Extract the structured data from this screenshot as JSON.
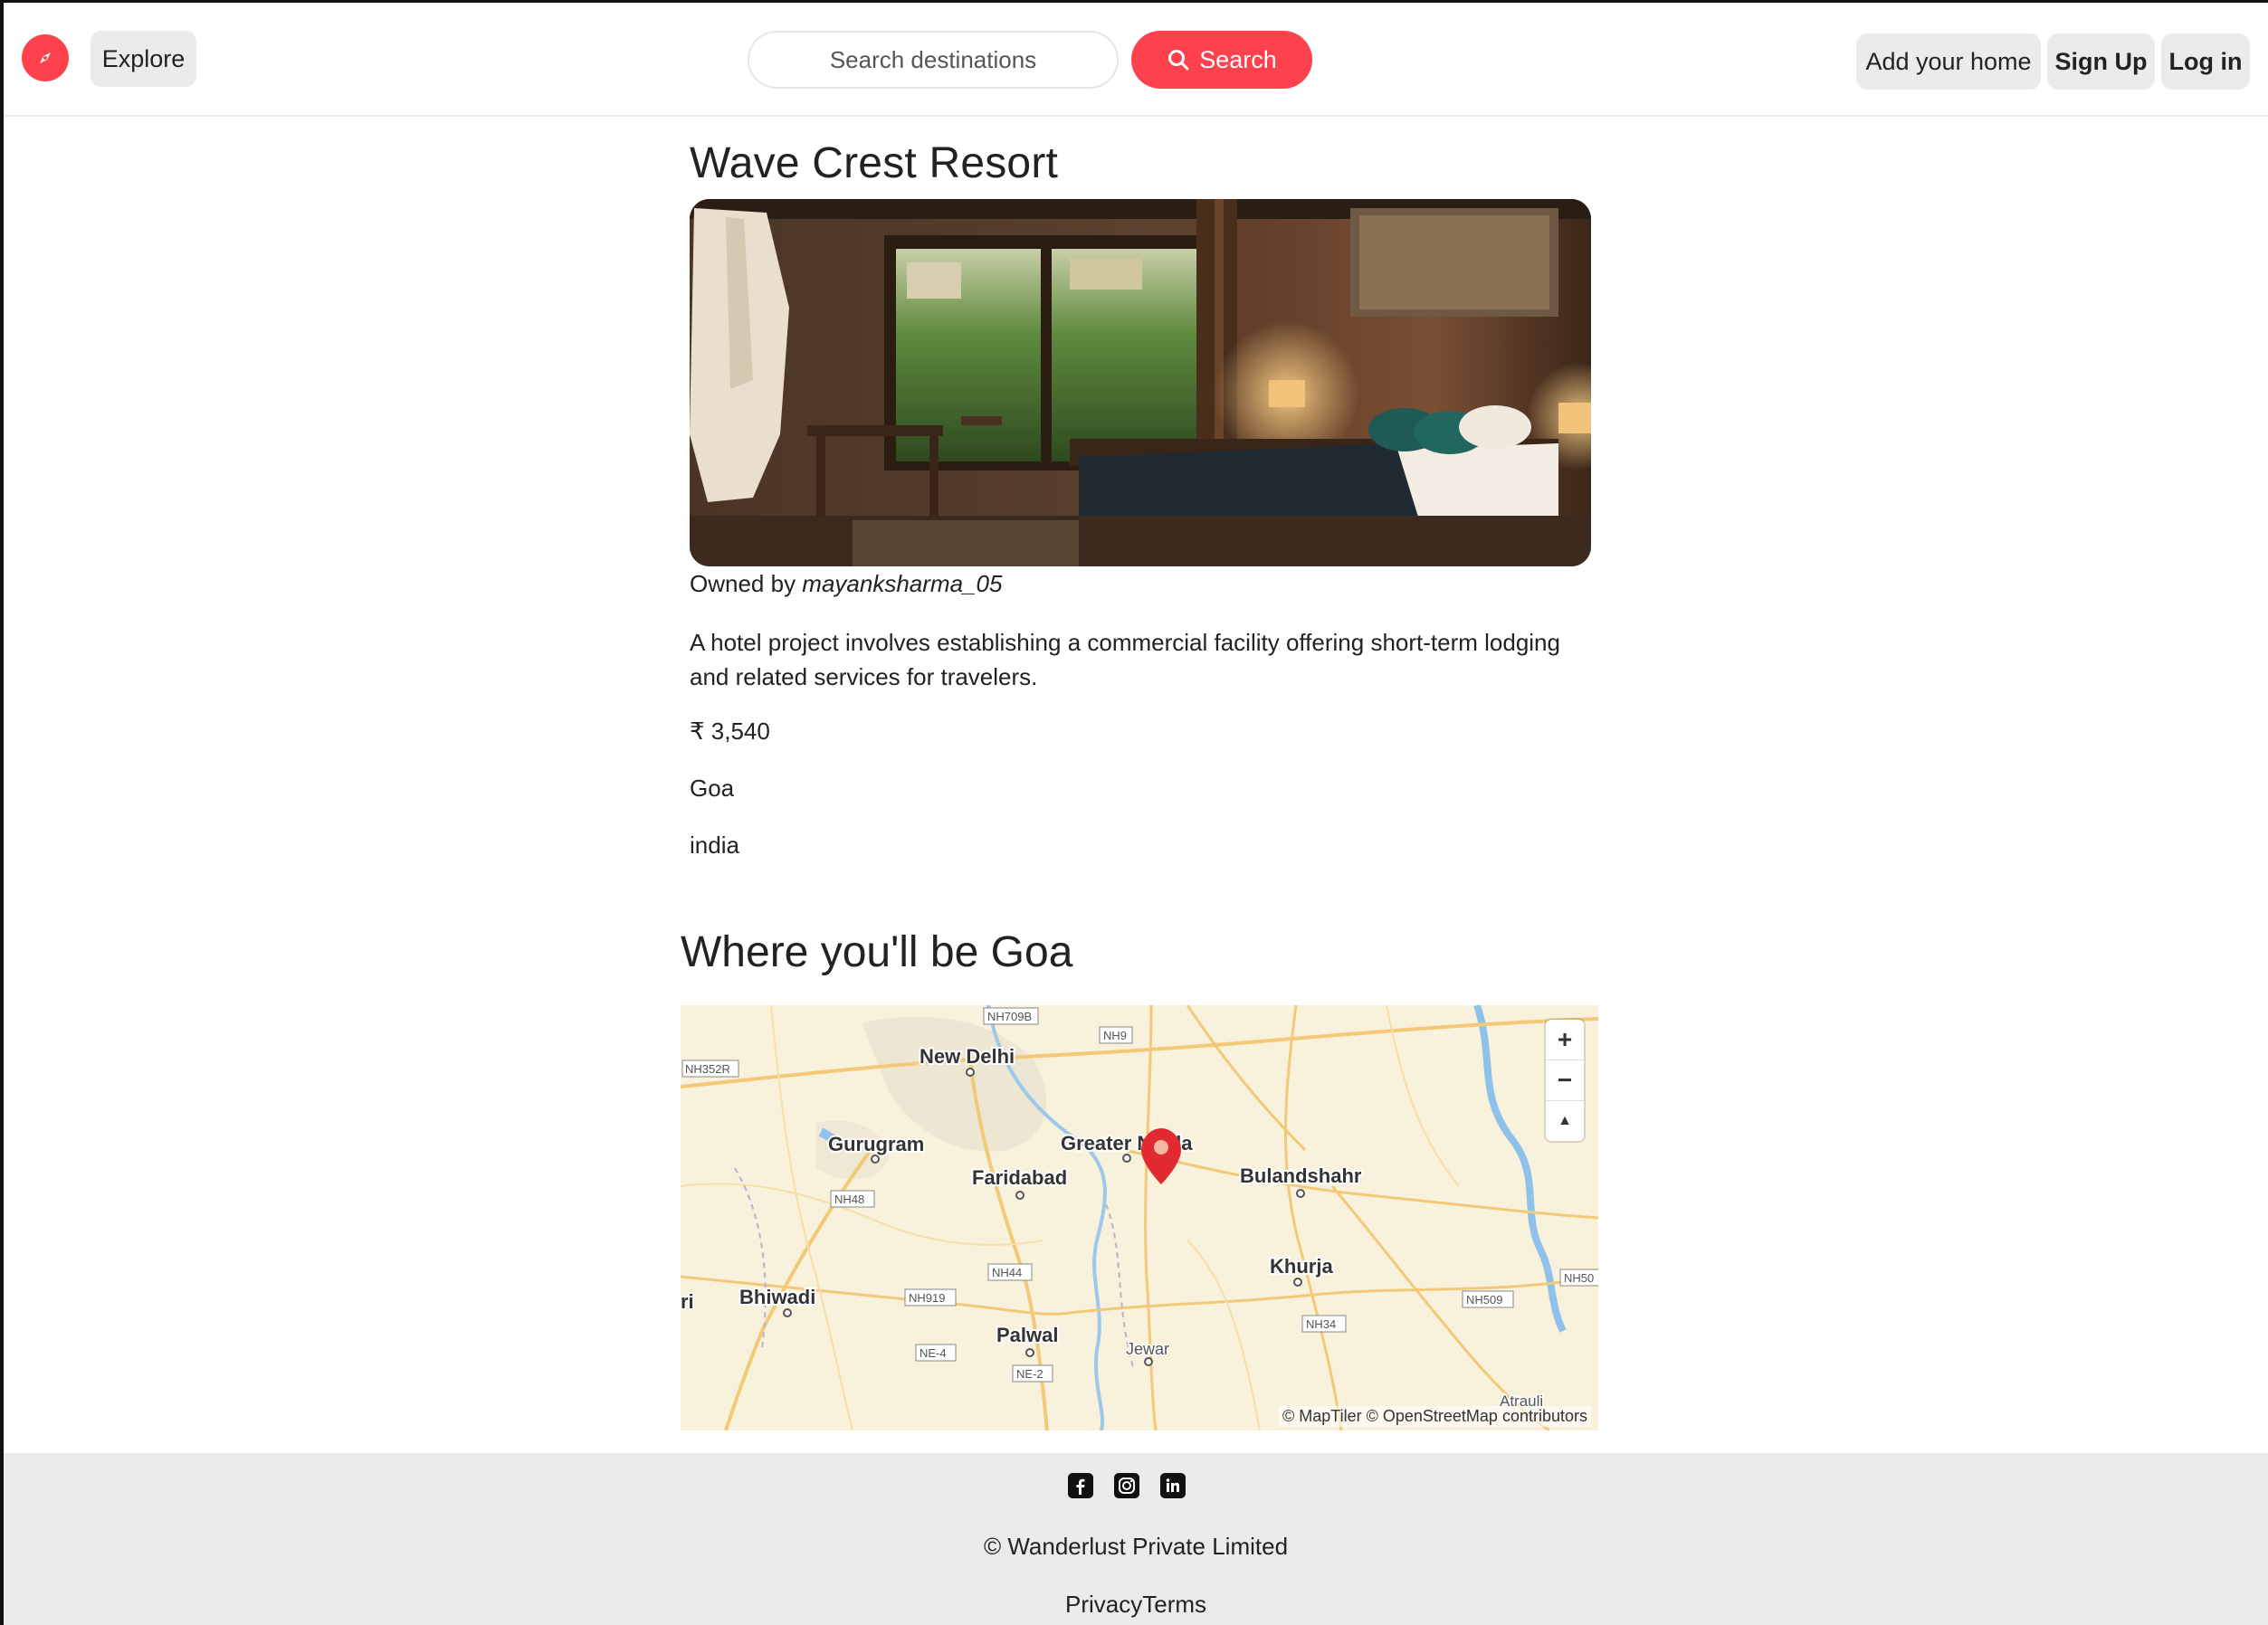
{
  "navbar": {
    "explore_label": "Explore",
    "search_placeholder": "Search destinations",
    "search_label": "Search",
    "add_home_label": "Add your home",
    "signup_label": "Sign Up",
    "login_label": "Log in",
    "brand_color": "#fe424d",
    "logo_icon": "compass-icon"
  },
  "listing": {
    "title": "Wave Crest Resort",
    "owned_prefix": "Owned by ",
    "owner": "mayanksharma_05",
    "description": "A hotel project involves establishing a commercial facility offering short-term lodging and related services for travelers.",
    "price": "₹ 3,540",
    "location": "Goa",
    "country": "india"
  },
  "map": {
    "title": "Where you'll be Goa",
    "attribution": "© MapTiler © OpenStreetMap contributors",
    "places": [
      "New Delhi",
      "Gurugram",
      "Greater Noida",
      "Faridabad",
      "Bulandshahr",
      "Khurja",
      "Bhiwadi",
      "Palwal",
      "Jewar",
      "Atrauli",
      "ri"
    ],
    "roads": [
      "NH709B",
      "NH9",
      "NH352R",
      "NH48",
      "NH44",
      "NH919",
      "NE-4",
      "NE-2",
      "NH34",
      "NH509",
      "NH50"
    ],
    "zoom_in": "+",
    "zoom_out": "−",
    "compass": "▲",
    "marker_color": "#e22a32"
  },
  "footer": {
    "social_icons": [
      "facebook-icon",
      "instagram-icon",
      "linkedin-icon"
    ],
    "copyright": "© Wanderlust Private Limited",
    "privacy": "Privacy",
    "terms": "Terms"
  }
}
